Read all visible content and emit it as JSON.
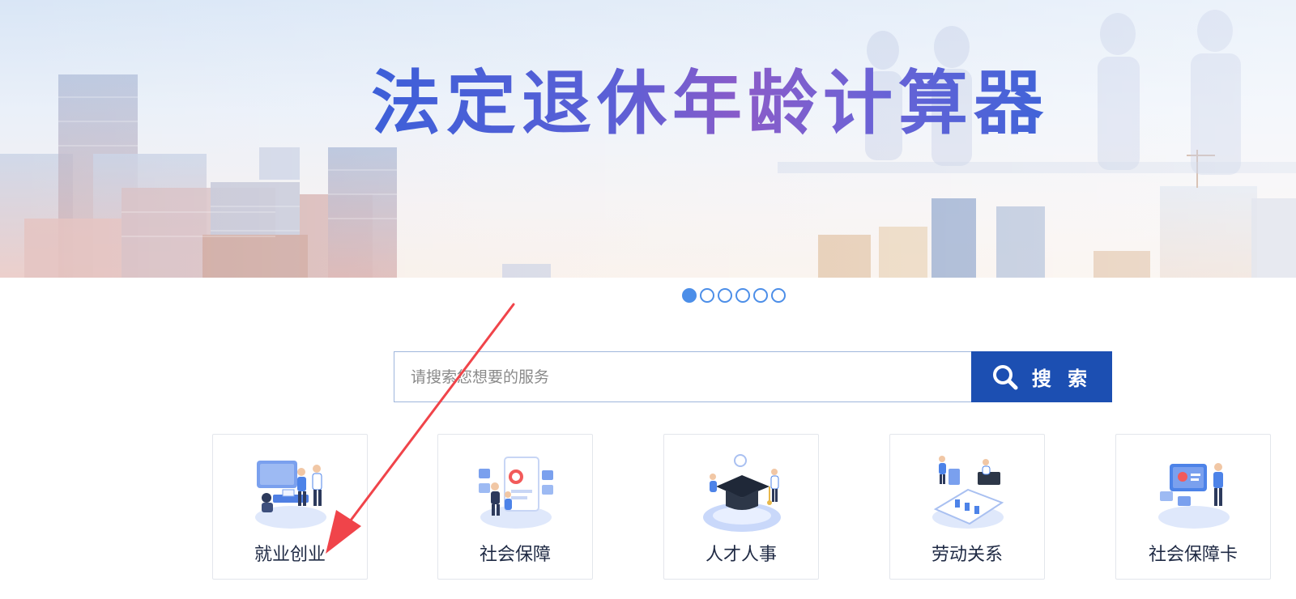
{
  "banner": {
    "title": "法定退休年龄计算器"
  },
  "carousel": {
    "total": 6,
    "active_index": 0
  },
  "search": {
    "placeholder": "请搜索您想要的服务",
    "value": "",
    "button_label": "搜 索",
    "icon": "search-icon"
  },
  "services": [
    {
      "label": "就业创业",
      "icon": "employment-illustration"
    },
    {
      "label": "社会保障",
      "icon": "social-security-illustration"
    },
    {
      "label": "人才人事",
      "icon": "talent-illustration"
    },
    {
      "label": "劳动关系",
      "icon": "labor-relations-illustration"
    },
    {
      "label": "社会保障卡",
      "icon": "social-security-card-illustration"
    }
  ],
  "colors": {
    "accent": "#1c4fb2",
    "dot": "#4c8ee8",
    "annotation": "#f0444a"
  }
}
